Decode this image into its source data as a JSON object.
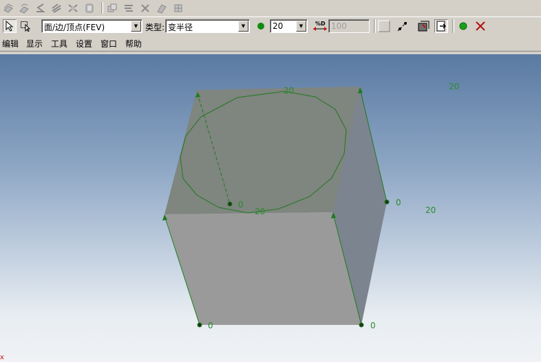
{
  "toolbar": {
    "feature_icons": [
      "extrude-icon",
      "revolve-icon",
      "sweep-icon",
      "loft-icon",
      "blend-icon",
      "shell-icon",
      "boolean-icon",
      "pattern-icon",
      "trim-icon",
      "mirror-icon",
      "transform-icon"
    ],
    "filter_value": "面/边/顶点(FEV)",
    "type_label": "类型:",
    "type_value": "变半径",
    "radius_value": "20",
    "percent_label": "%D",
    "percent_value": "100"
  },
  "menu": {
    "items": [
      "编辑",
      "显示",
      "工具",
      "设置",
      "窗口",
      "帮助"
    ]
  },
  "viewport": {
    "dim_top": "20",
    "dim_top_right": "20",
    "dim_right": "20",
    "dim_front": "20",
    "vertex_center": "0",
    "vertex_right": "0",
    "vertex_bottom_left": "0",
    "vertex_bottom_right": "0",
    "axis_marker": "x"
  },
  "colors": {
    "edge": "#1e7a1e",
    "dimension_text": "#2a8a2a",
    "accept": "#18a018",
    "cancel": "#b01010"
  }
}
